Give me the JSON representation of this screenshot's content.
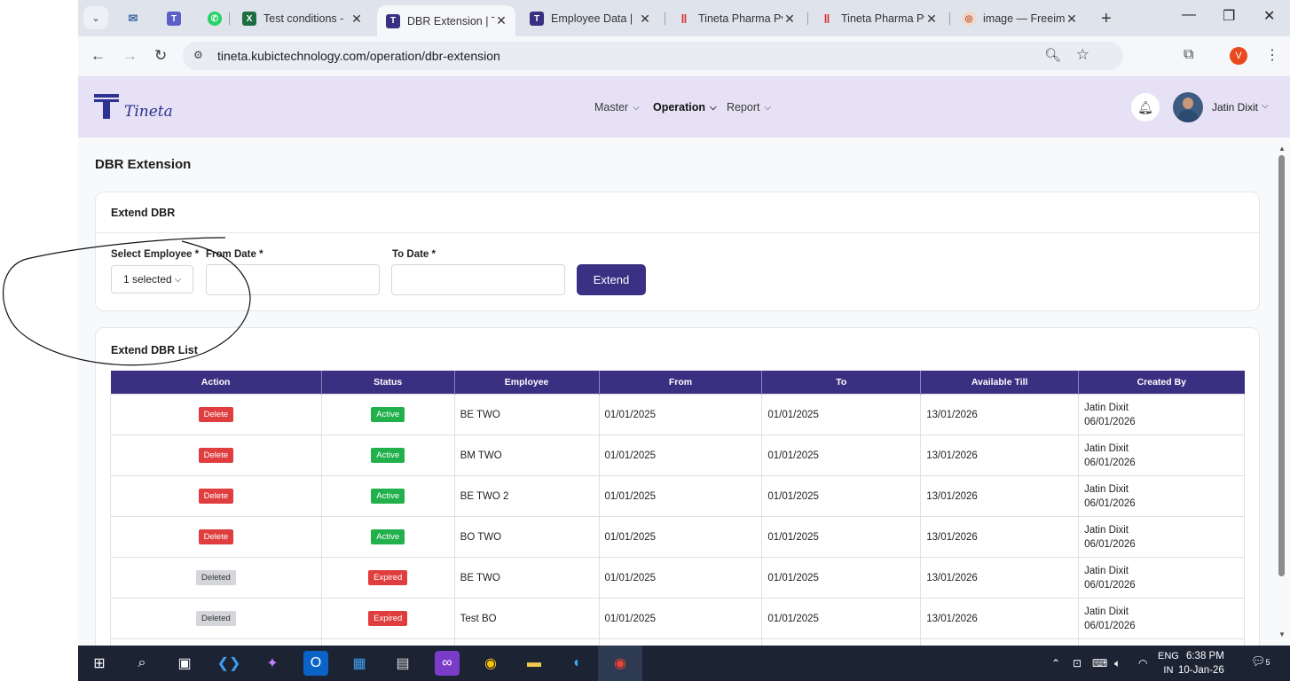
{
  "browser": {
    "tabs": [
      {
        "title": "",
        "icon": "envelope-open-icon"
      },
      {
        "title": "",
        "icon": "teams-icon"
      },
      {
        "title": "",
        "icon": "whatsapp-icon"
      },
      {
        "title": "Test conditions -",
        "icon": "excel-icon"
      },
      {
        "title": "DBR Extension | T",
        "icon": "tineta-icon",
        "active": true
      },
      {
        "title": "Employee Data |",
        "icon": "tineta-icon"
      },
      {
        "title": "Tineta Pharma Pv",
        "icon": "tineta-pharma-icon"
      },
      {
        "title": "Tineta Pharma Pv",
        "icon": "tineta-pharma-icon"
      },
      {
        "title": "image — Freeima",
        "icon": "freeimage-icon"
      }
    ],
    "url": "tineta.kubictechnology.com/operation/dbr-extension",
    "profile_initial": "V",
    "profile_color": "#e8491d"
  },
  "app": {
    "logo_text": "Tineta",
    "nav": [
      {
        "label": "Master"
      },
      {
        "label": "Operation",
        "active": true
      },
      {
        "label": "Report"
      }
    ],
    "user_name": "Jatin Dixit",
    "brand_color": "#3b2f82",
    "header_bg": "#e6e1f5"
  },
  "page": {
    "title": "DBR Extension",
    "form_card": {
      "title": "Extend DBR",
      "employee_label": "Select Employee *",
      "employee_value": "1 selected",
      "from_label": "From Date *",
      "from_value": "",
      "to_label": "To Date *",
      "to_value": "",
      "extend_button": "Extend"
    },
    "list_card": {
      "title": "Extend DBR List",
      "columns": [
        "Action",
        "Status",
        "Employee",
        "From",
        "To",
        "Available Till",
        "Created By"
      ],
      "rows": [
        {
          "action": "Delete",
          "status": "Active",
          "employee": "BE TWO",
          "from": "01/01/2025",
          "to": "01/01/2025",
          "available_till": "13/01/2026",
          "created_by": "Jatin Dixit",
          "created_on": "06/01/2026"
        },
        {
          "action": "Delete",
          "status": "Active",
          "employee": "BM TWO",
          "from": "01/01/2025",
          "to": "01/01/2025",
          "available_till": "13/01/2026",
          "created_by": "Jatin Dixit",
          "created_on": "06/01/2026"
        },
        {
          "action": "Delete",
          "status": "Active",
          "employee": "BE TWO 2",
          "from": "01/01/2025",
          "to": "01/01/2025",
          "available_till": "13/01/2026",
          "created_by": "Jatin Dixit",
          "created_on": "06/01/2026"
        },
        {
          "action": "Delete",
          "status": "Active",
          "employee": "BO TWO",
          "from": "01/01/2025",
          "to": "01/01/2025",
          "available_till": "13/01/2026",
          "created_by": "Jatin Dixit",
          "created_on": "06/01/2026"
        },
        {
          "action": "Deleted",
          "status": "Expired",
          "employee": "BE TWO",
          "from": "01/01/2025",
          "to": "01/01/2025",
          "available_till": "13/01/2026",
          "created_by": "Jatin Dixit",
          "created_on": "06/01/2026"
        },
        {
          "action": "Deleted",
          "status": "Expired",
          "employee": "Test BO",
          "from": "01/01/2025",
          "to": "01/01/2025",
          "available_till": "13/01/2026",
          "created_by": "Jatin Dixit",
          "created_on": "06/01/2026"
        }
      ]
    }
  },
  "taskbar": {
    "apps": [
      "start-icon",
      "search-icon",
      "task-view-icon",
      "vscode-icon",
      "copilot-icon",
      "outlook-icon",
      "store-icon",
      "calculator-icon",
      "clipchamp-icon",
      "chrome-icon",
      "file-explorer-icon",
      "edge-icon",
      "chrome-active-icon"
    ],
    "lang_line1": "ENG",
    "lang_line2": "IN",
    "time": "6:38 PM",
    "date": "10-Jan-26",
    "notification_count": "5"
  }
}
